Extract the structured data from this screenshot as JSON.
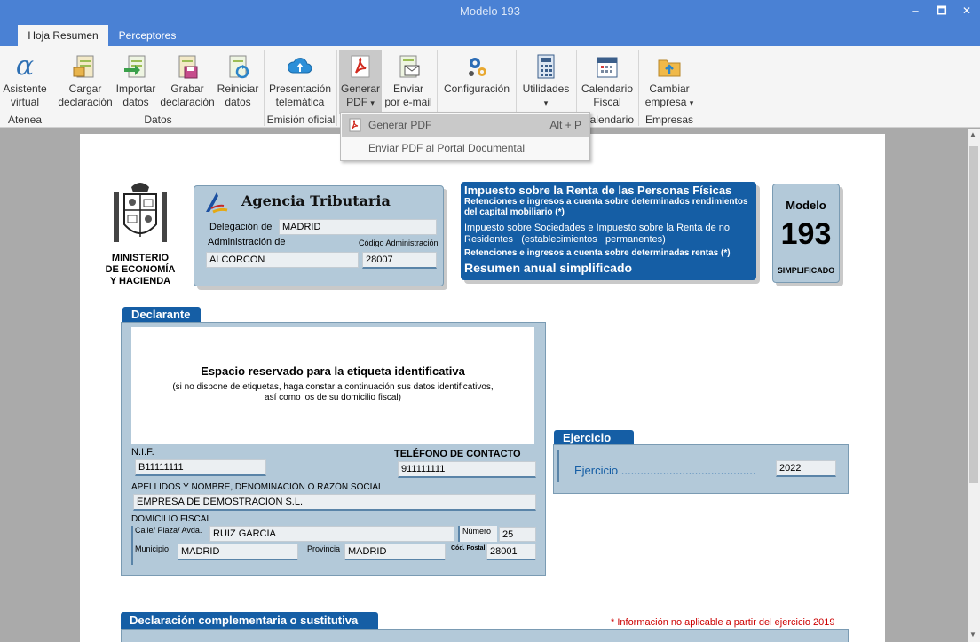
{
  "window": {
    "title": "Modelo 193",
    "minimize": "🗕",
    "maximize": "🗖",
    "close": "✕"
  },
  "tabs": [
    {
      "label": "Hoja Resumen",
      "active": true
    },
    {
      "label": "Perceptores",
      "active": false
    }
  ],
  "ribbon": {
    "buttons": {
      "asistente": {
        "line1": "Asistente",
        "line2": "virtual",
        "icon": "alpha-icon"
      },
      "cargar": {
        "line1": "Cargar",
        "line2": "declaración",
        "icon": "load-document-icon"
      },
      "importar": {
        "line1": "Importar",
        "line2": "datos",
        "icon": "import-document-icon"
      },
      "grabar": {
        "line1": "Grabar",
        "line2": "declaración",
        "icon": "save-document-icon"
      },
      "reiniciar": {
        "line1": "Reiniciar",
        "line2": "datos",
        "icon": "reset-document-icon"
      },
      "presentacion": {
        "line1": "Presentación",
        "line2": "telemática",
        "icon": "cloud-upload-icon"
      },
      "generar": {
        "line1": "Generar",
        "line2": "PDF",
        "arrow": "▾",
        "icon": "pdf-icon"
      },
      "enviar": {
        "line1": "Enviar",
        "line2": "por e-mail",
        "icon": "email-icon"
      },
      "configuracion": {
        "line1": "Configuración",
        "line2": "",
        "icon": "settings-icon"
      },
      "utilidades": {
        "line1": "Utilidades",
        "line2": "▾",
        "icon": "calculator-icon"
      },
      "calendario": {
        "line1": "Calendario",
        "line2": "Fiscal",
        "icon": "calendar-icon"
      },
      "cambiar": {
        "line1": "Cambiar",
        "line2": "empresa",
        "arrow": "▾",
        "icon": "folder-icon"
      }
    },
    "groups": {
      "atenea": "Atenea",
      "datos": "Datos",
      "emision": "Emisión oficial",
      "calendario": "alendario",
      "empresas": "Empresas"
    }
  },
  "pdf_menu": {
    "items": [
      {
        "label": "Generar PDF",
        "shortcut": "Alt + P",
        "highlighted": true
      },
      {
        "label": "Enviar PDF al Portal Documental",
        "shortcut": "",
        "highlighted": false
      }
    ]
  },
  "form": {
    "ministry": {
      "line1": "MINISTERIO",
      "line2": "DE ECONOMÍA",
      "line3": "Y HACIENDA"
    },
    "agency": {
      "name": "Agencia Tributaria",
      "delegacion_label": "Delegación de",
      "delegacion_value": "MADRID",
      "administracion_label": "Administración de",
      "administracion_value": "ALCORCON",
      "codigo_label": "Código Administración",
      "codigo_value": "28007"
    },
    "tax": {
      "line1": "Impuesto sobre la Renta de las Personas Físicas",
      "line2": "Retenciones e ingresos a cuenta sobre determinados rendimientos",
      "line3": "del capital mobiliario (*)",
      "line4": "Impuesto sobre Sociedades e Impuesto sobre la Renta de no",
      "line5": "Residentes   (establecimientos   permanentes)",
      "line6": "Retenciones e ingresos a cuenta sobre determinadas rentas (*)",
      "line7": "Resumen anual simplificado"
    },
    "modelo": {
      "label": "Modelo",
      "number": "193",
      "sub": "SIMPLIFICADO"
    },
    "declarante": {
      "header": "Declarante",
      "label_title": "Espacio reservado para la etiqueta identificativa",
      "label_sub1": "(si no dispone de etiquetas, haga constar a continuación sus datos identificativos,",
      "label_sub2": "así como los de su domicilio fiscal)",
      "nif_label": "N.I.F.",
      "nif_value": "B11111111",
      "telefono_label": "TELÉFONO DE CONTACTO",
      "telefono_value": "911111111",
      "nombre_label": "APELLIDOS Y NOMBRE, DENOMINACIÓN O RAZÓN SOCIAL",
      "nombre_value": "EMPRESA DE DEMOSTRACION S.L.",
      "domicilio_label": "DOMICILIO FISCAL",
      "calle_label": "Calle/ Plaza/ Avda.",
      "calle_value": "RUIZ GARCIA",
      "numero_label": "Número",
      "numero_value": "25",
      "municipio_label": "Municipio",
      "municipio_value": "MADRID",
      "provincia_label": "Provincia",
      "provincia_value": "MADRID",
      "cp_label": "Cód. Postal",
      "cp_value": "28001"
    },
    "ejercicio": {
      "header": "Ejercicio",
      "label": "Ejercicio ..........................................",
      "value": "2022"
    },
    "complementaria": {
      "header": "Declaración complementaria o sustitutiva",
      "note": "* Información no aplicable a partir del ejercicio 2019"
    }
  },
  "colors": {
    "titlebar": "#4a81d4",
    "section_header": "#155ea5",
    "form_box": "#b3c9d9",
    "note_red": "#cc0000"
  }
}
